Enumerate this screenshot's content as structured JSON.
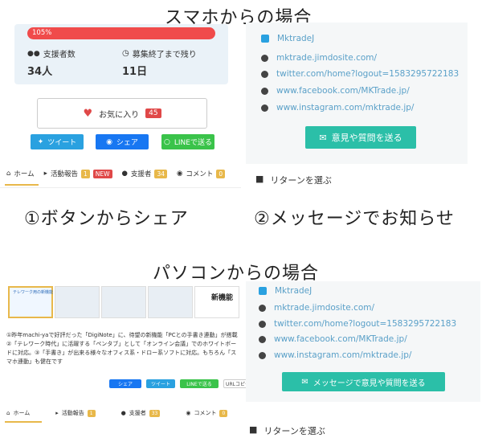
{
  "top_heading": "スマホからの場合",
  "mobile": {
    "progress_label": "105%",
    "supporters_label": "支援者数",
    "time_left_label": "募集終了まで残り",
    "supporters_value": "34人",
    "days_value": "11日",
    "favorite_label": "お気に入り",
    "favorite_count": "45",
    "tweet_label": "ツイート",
    "share_label": "シェア",
    "line_label": "LINEで送る",
    "tabs": [
      {
        "label": "ホーム"
      },
      {
        "label": "活動報告",
        "count": "1",
        "new": "NEW"
      },
      {
        "label": "支援者",
        "count": "34"
      },
      {
        "label": "コメント",
        "count": "0"
      }
    ],
    "caption": "①ボタンからシェア"
  },
  "contact_mobile": {
    "twitter_name": "MktradeJ",
    "links": [
      "mktrade.jimdosite.com/",
      "twitter.com/home?logout=1583295722183",
      "www.facebook.com/MKTrade.jp/",
      "www.instagram.com/mktrade.jp/"
    ],
    "button_label": "意見や質問を送る",
    "return_label": "リターンを選ぶ",
    "caption": "②メッセージでお知らせ"
  },
  "pc_heading": "パソコンからの場合",
  "pc": {
    "banner_title": "テレワーク用の新機能",
    "new_feature": "新機能",
    "description": "①昨年machi-yaで好評だった「DigiNote」に、待望の新機能「PCとの手書き連動」が搭載　②「テレワーク時代」に活躍する「ペンタブ」として「オンライン会議」でのホワイトボードに対応。③「手書き」が出来る様々なオフィス系・ドロー系ソフトに対応。もちろん「スマホ連動」も健在です",
    "share_label": "シェア",
    "tweet_label": "ツイート",
    "line_label": "LINEで送る",
    "copy_label": "URLコピー",
    "tabs": [
      {
        "label": "ホーム"
      },
      {
        "label": "活動報告",
        "count": "1"
      },
      {
        "label": "支援者",
        "count": "33"
      },
      {
        "label": "コメント",
        "count": "0"
      }
    ]
  },
  "contact_pc": {
    "twitter_name": "MktradeJ",
    "links": [
      "mktrade.jimdosite.com/",
      "twitter.com/home?logout=1583295722183",
      "www.facebook.com/MKTrade.jp/",
      "www.instagram.com/mktrade.jp/"
    ],
    "button_label": "メッセージで意見や質問を送る",
    "return_label": "リターンを選ぶ"
  },
  "colors": {
    "red": "#f04b4b",
    "teal": "#2bbfa8",
    "twitter": "#2aa1e0",
    "facebook": "#1877f2",
    "line": "#3ac34a",
    "tab_underline": "#e8b84a"
  }
}
